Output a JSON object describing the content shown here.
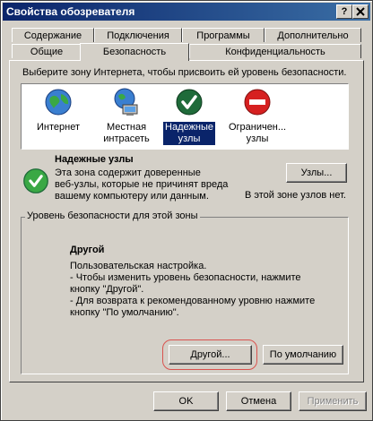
{
  "window": {
    "title": "Свойства обозревателя"
  },
  "title_buttons": {
    "help": "?",
    "close": "X"
  },
  "tabs_row1": [
    "Содержание",
    "Подключения",
    "Программы",
    "Дополнительно"
  ],
  "tabs_row2": [
    "Общие",
    "Безопасность",
    "Конфиденциальность"
  ],
  "security": {
    "instruction": "Выберите зону Интернета, чтобы присвоить ей уровень безопасности.",
    "zones": [
      {
        "label": "Интернет",
        "icon": "globe-icon"
      },
      {
        "label": "Местная\nинтрасеть",
        "icon": "intranet-icon"
      },
      {
        "label": "Надежные\nузлы",
        "icon": "trusted-check-icon"
      },
      {
        "label": "Ограничен...\nузлы",
        "icon": "restricted-icon"
      }
    ],
    "selected_zone": {
      "title": "Надежные узлы",
      "description_lines": [
        "Эта зона содержит доверенные",
        "веб-узлы, которые не причинят вреда",
        "вашему компьютеру или данным."
      ],
      "sites_button": "Узлы...",
      "sites_note": "В этой зоне узлов нет."
    },
    "level_group": {
      "legend": "Уровень безопасности для этой зоны",
      "level_title": "Другой",
      "lines": [
        "Пользовательская настройка.",
        "- Чтобы изменить уровень безопасности, нажмите",
        "кнопку \"Другой\".",
        "- Для возврата к рекомендованному уровню нажмите",
        "кнопку \"По умолчанию\"."
      ],
      "custom_button": "Другой...",
      "default_button": "По умолчанию"
    }
  },
  "dialog_buttons": {
    "ok": "OK",
    "cancel": "Отмена",
    "apply": "Применить"
  },
  "colors": {
    "titlebar_start": "#0a246a",
    "titlebar_end": "#3a6ea5",
    "face": "#d4d0c8",
    "highlight_ring": "#d9534f"
  }
}
